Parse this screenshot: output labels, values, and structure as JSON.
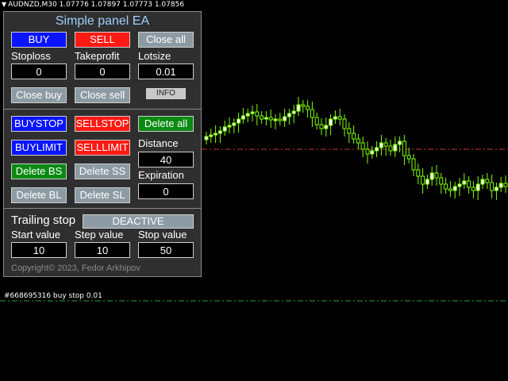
{
  "header": {
    "triangle": "▼",
    "text": "AUDNZD,M30  1.07776 1.07897 1.07773 1.07856"
  },
  "order_label": "#668695316 buy stop 0.01",
  "chart": {
    "bull_color": "#7fff00",
    "bear_color": "#ffffff",
    "sell_line_color": "#c0392b",
    "buy_line_color": "#2e9e3e"
  },
  "panel": {
    "title": "Simple panel EA",
    "buy": "BUY",
    "sell": "SELL",
    "close_all": "Close all",
    "stoploss_label": "Stoploss",
    "takeprofit_label": "Takeprofit",
    "lotsize_label": "Lotsize",
    "stoploss_value": "0",
    "takeprofit_value": "0",
    "lotsize_value": "0.01",
    "close_buy": "Close buy",
    "close_sell": "Close sell",
    "info": "INFO",
    "buystop": "BUYSTOP",
    "sellstop": "SELLSTOP",
    "delete_all": "Delete all",
    "buylimit": "BUYLIMIT",
    "selllimit": "SELLLIMIT",
    "distance_label": "Distance",
    "distance_value": "40",
    "delete_bs": "Delete BS",
    "delete_ss": "Delete SS",
    "expiration_label": "Expiration",
    "expiration_value": "0",
    "delete_bl": "Delete BL",
    "delete_sl": "Delete SL",
    "trailing_label": "Trailing stop",
    "trailing_state": "DEACTIVE",
    "start_value_label": "Start value",
    "step_value_label": "Step value",
    "stop_value_label": "Stop value",
    "start_value": "10",
    "step_value": "10",
    "stop_value": "50",
    "copyright": "Copyright© 2023, Fedor Arkhipov"
  }
}
